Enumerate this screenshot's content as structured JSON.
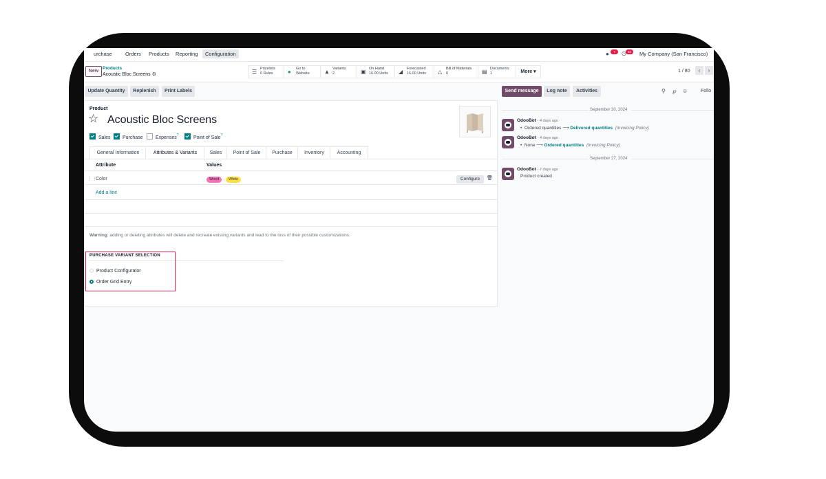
{
  "nav": {
    "app": "urchase",
    "items": [
      "Orders",
      "Products",
      "Reporting",
      "Configuration"
    ],
    "chat_badge": "7",
    "activity_badge": "52",
    "company": "My Company (San Francisco)"
  },
  "control": {
    "new_label": "New",
    "breadcrumb_parent": "Products",
    "breadcrumb_current": "Acoustic Bloc Screens",
    "pager": "1 / 80",
    "more_label": "More",
    "stats": [
      {
        "icon": "list-icon",
        "line1": "Pricelists",
        "line2": "0 Rules"
      },
      {
        "icon": "globe-icon",
        "line1": "Go to",
        "line2": "Website"
      },
      {
        "icon": "sitemap-icon",
        "line1": "Variants",
        "line2": "2"
      },
      {
        "icon": "cubes-icon",
        "line1": "On Hand",
        "line2": "16.00 Units"
      },
      {
        "icon": "area-chart-icon",
        "line1": "Forecasted",
        "line2": "16.00 Units"
      },
      {
        "icon": "flask-icon",
        "line1": "Bill of Materials",
        "line2": "0"
      },
      {
        "icon": "document-icon",
        "line1": "Documents",
        "line2": "1"
      }
    ]
  },
  "actions": [
    "Update Quantity",
    "Replenish",
    "Print Labels"
  ],
  "form": {
    "label": "Product",
    "name": "Acoustic Bloc Screens",
    "checkboxes": [
      {
        "label": "Sales",
        "checked": true
      },
      {
        "label": "Purchase",
        "checked": true
      },
      {
        "label": "Expenses",
        "checked": false
      },
      {
        "label": "Point of Sale",
        "checked": true
      }
    ],
    "help_mark": "?",
    "tabs": [
      "General Information",
      "Attributes & Variants",
      "Sales",
      "Point of Sale",
      "Purchase",
      "Inventory",
      "Accounting"
    ],
    "active_tab": "Attributes & Variants",
    "table": {
      "headers": [
        "Attribute",
        "Values"
      ],
      "rows": [
        {
          "attribute": "Color",
          "values": [
            {
              "label": "Wood",
              "color": "#f472b6"
            },
            {
              "label": "White",
              "color": "#fde047"
            }
          ],
          "action": "Configure"
        }
      ],
      "add_line": "Add a line"
    },
    "warning_label": "Warning",
    "warning_text": ": adding or deleting attributes will delete and recreate existing variants and lead to the loss of their possible customizations.",
    "section_title": "PURCHASE VARIANT SELECTION",
    "options": [
      {
        "label": "Product Configurator",
        "selected": false
      },
      {
        "label": "Order Grid Entry",
        "selected": true
      }
    ]
  },
  "chatter": {
    "send_message": "Send message",
    "log_note": "Log note",
    "activities": "Activities",
    "follow": "Follo",
    "groups": [
      {
        "date": "September 30, 2024",
        "messages": [
          {
            "author": "OdooBot",
            "ago": "- 4 days ago",
            "from": "Ordered quantities",
            "to": "Delivered quantities",
            "field": "(Invoicing Policy)"
          },
          {
            "author": "OdooBot",
            "ago": "- 4 days ago",
            "from": "None",
            "to": "Ordered quantities",
            "field": "(Invoicing Policy)"
          }
        ]
      },
      {
        "date": "September 27, 2024",
        "messages": [
          {
            "author": "OdooBot",
            "ago": "- 7 days ago",
            "text": "Product created"
          }
        ]
      }
    ]
  },
  "colors": {
    "primary": "#714b67",
    "accent": "#017e84",
    "highlight_box": "#e11d48"
  }
}
